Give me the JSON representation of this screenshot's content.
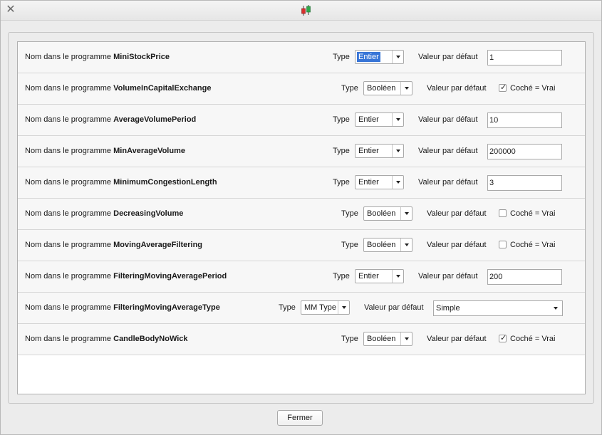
{
  "window": {
    "close_icon": "close-icon",
    "app_icon": "candlestick-icon"
  },
  "labels": {
    "name_prefix": "Nom dans le programme",
    "type": "Type",
    "default": "Valeur par défaut",
    "checked_label": "Coché = Vrai"
  },
  "rows": [
    {
      "name": "MiniStockPrice",
      "type": "Entier",
      "kind": "int",
      "value": "1",
      "focused": true
    },
    {
      "name": "VolumeInCapitalExchange",
      "type": "Booléen",
      "kind": "bool",
      "checked": true
    },
    {
      "name": "AverageVolumePeriod",
      "type": "Entier",
      "kind": "int",
      "value": "10"
    },
    {
      "name": "MinAverageVolume",
      "type": "Entier",
      "kind": "int",
      "value": "200000"
    },
    {
      "name": "MinimumCongestionLength",
      "type": "Entier",
      "kind": "int",
      "value": "3"
    },
    {
      "name": "DecreasingVolume",
      "type": "Booléen",
      "kind": "bool",
      "checked": false
    },
    {
      "name": "MovingAverageFiltering",
      "type": "Booléen",
      "kind": "bool",
      "checked": false
    },
    {
      "name": "FilteringMovingAveragePeriod",
      "type": "Entier",
      "kind": "int",
      "value": "200"
    },
    {
      "name": "FilteringMovingAverageType",
      "type": "MM Type",
      "kind": "enum",
      "value": "Simple"
    },
    {
      "name": "CandleBodyNoWick",
      "type": "Booléen",
      "kind": "bool",
      "checked": true
    }
  ],
  "footer": {
    "close_button": "Fermer"
  },
  "colors": {
    "accent": "#3875d7",
    "candle_red": "#d9302c",
    "candle_green": "#2fa84a"
  }
}
